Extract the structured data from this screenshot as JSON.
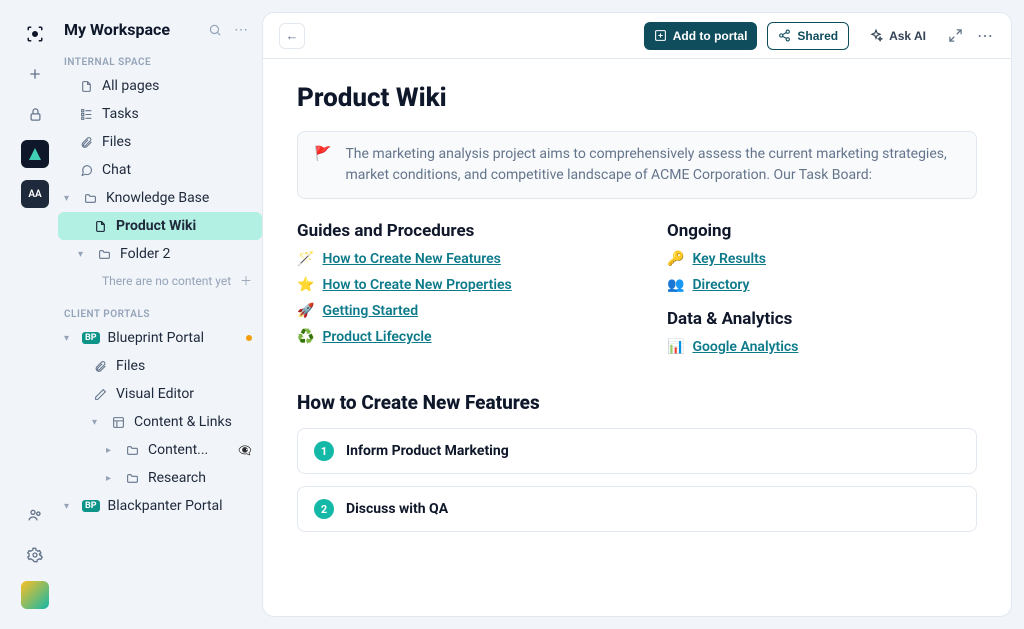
{
  "workspace": {
    "title": "My Workspace"
  },
  "sections": {
    "internal": "INTERNAL SPACE",
    "portals": "CLIENT PORTALS"
  },
  "nav": {
    "all_pages": "All pages",
    "tasks": "Tasks",
    "files": "Files",
    "chat": "Chat",
    "knowledge_base": "Knowledge Base",
    "product_wiki": "Product Wiki",
    "folder2": "Folder 2",
    "empty": "There are no content yet",
    "blueprint": "Blueprint Portal",
    "bp_files": "Files",
    "visual_editor": "Visual Editor",
    "content_links": "Content & Links",
    "content_trunc": "Content...",
    "research": "Research",
    "blackpanther": "Blackpanter Portal",
    "bp_badge": "BP"
  },
  "topbar": {
    "add_portal": "Add to portal",
    "shared": "Shared",
    "ask_ai": "Ask AI"
  },
  "page": {
    "title": "Product Wiki",
    "callout": "The marketing analysis project aims to comprehensively assess the current marketing strategies, market conditions, and competitive landscape of ACME Corporation. Our Task Board:",
    "columns": {
      "guides": {
        "heading": "Guides and Procedures",
        "links": [
          {
            "emoji": "🪄",
            "label": "How to Create New Features"
          },
          {
            "emoji": "⭐",
            "label": "How to Create New Properties"
          },
          {
            "emoji": "🚀",
            "label": "Getting Started"
          },
          {
            "emoji": "♻️",
            "label": "Product Lifecycle"
          }
        ]
      },
      "ongoing": {
        "heading": "Ongoing",
        "links": [
          {
            "emoji": "🔑",
            "label": "Key Results"
          },
          {
            "emoji": "👥",
            "label": "Directory"
          }
        ]
      },
      "data": {
        "heading": "Data & Analytics",
        "links": [
          {
            "emoji": "📊",
            "label": "Google Analytics"
          }
        ]
      }
    },
    "how_section": {
      "heading": "How to Create New Features",
      "steps": [
        {
          "n": "1",
          "label": "Inform Product Marketing"
        },
        {
          "n": "2",
          "label": "Discuss with QA"
        }
      ]
    }
  },
  "rail": {
    "aa": "AA"
  }
}
